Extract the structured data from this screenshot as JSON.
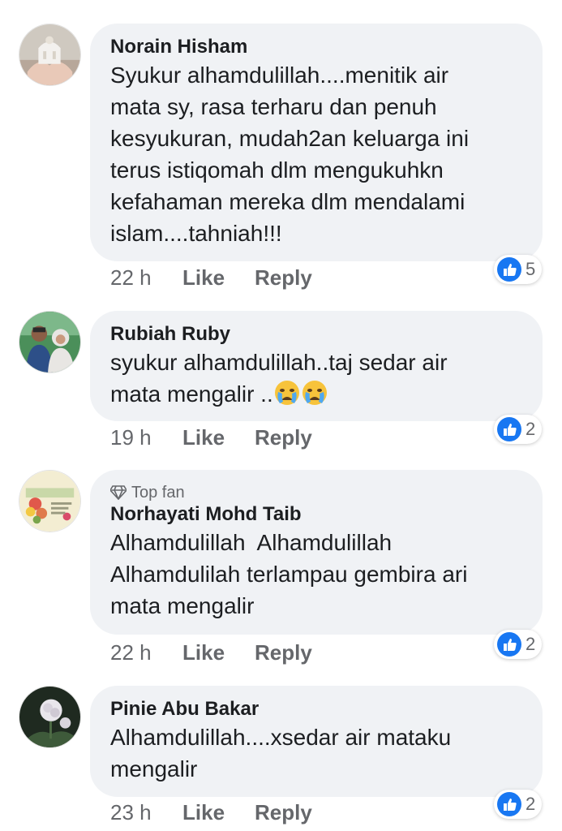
{
  "comments": [
    {
      "author": "Norain Hisham",
      "badge": "",
      "text": "Syukur alhamdulillah....menitik air\nmata sy, rasa terharu dan penuh\nkesyukuran, mudah2an keluarga ini\nterus istiqomah dlm mengukuhkn\nkefahaman mereka dlm mendalami\nislam....tahniah!!!",
      "time": "22 h",
      "like_label": "Like",
      "reply_label": "Reply",
      "reaction_count": "5"
    },
    {
      "author": "Rubiah Ruby",
      "badge": "",
      "text": "syukur alhamdulillah..taj sedar air\nmata mengalir ..",
      "emojis": [
        "crying-face",
        "crying-face"
      ],
      "time": "19 h",
      "like_label": "Like",
      "reply_label": "Reply",
      "reaction_count": "2"
    },
    {
      "author": "Norhayati Mohd Taib",
      "badge": "Top fan",
      "text": "Alhamdulillah  Alhamdulillah\nAlhamdulilah terlampau gembira ari\nmata mengalir",
      "time": "22 h",
      "like_label": "Like",
      "reply_label": "Reply",
      "reaction_count": "2"
    },
    {
      "author": "Pinie Abu Bakar",
      "badge": "",
      "text": "Alhamdulillah....xsedar air mataku\nmengalir",
      "time": "23 h",
      "like_label": "Like",
      "reply_label": "Reply",
      "reaction_count": "2"
    }
  ],
  "colors": {
    "bubble": "#f0f2f5",
    "name": "#1c1e21",
    "meta": "#65676b",
    "like_blue": "#1877f2"
  },
  "icons": {
    "reaction": "thumbs-up-icon",
    "badge": "diamond-icon"
  }
}
